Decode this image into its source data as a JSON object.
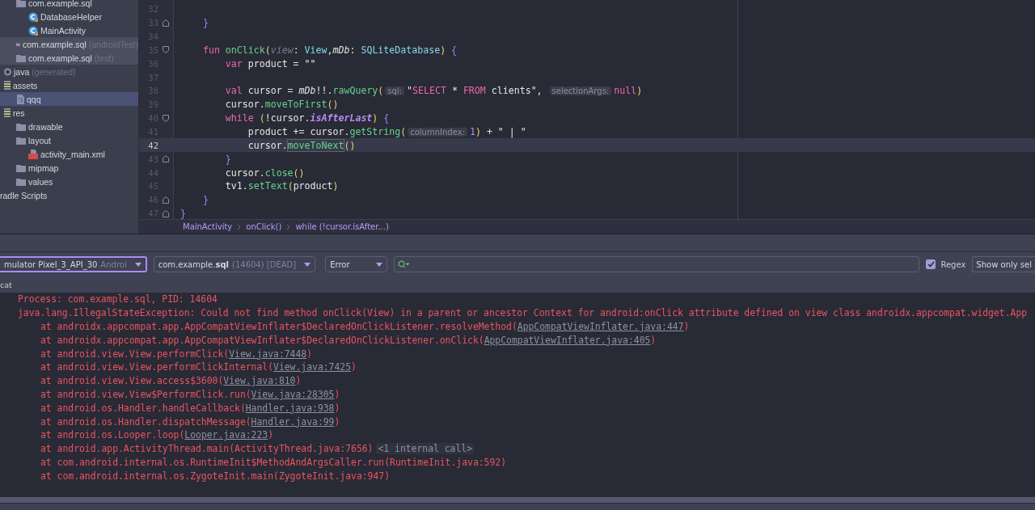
{
  "project_tree": {
    "continued_items": [
      {
        "label": "com.example.sql",
        "kind": "package",
        "selected": false,
        "shaded": false,
        "children": [
          {
            "label": "DatabaseHelper",
            "kind": "class",
            "selected": false,
            "shaded": false
          },
          {
            "label": "MainActivity",
            "kind": "class",
            "selected": false,
            "shaded": false
          }
        ]
      },
      {
        "label": "com.example.sql",
        "suffix": "(androidTest)",
        "kind": "package",
        "selected": false,
        "shaded": true
      },
      {
        "label": "com.example.sql",
        "suffix": "(test)",
        "kind": "package",
        "selected": false,
        "shaded": true
      }
    ],
    "items": [
      {
        "label": "java",
        "suffix": "(generated)",
        "kind": "generated",
        "selected": false,
        "shaded": false
      },
      {
        "label": "assets",
        "kind": "resource-folder",
        "selected": false,
        "shaded": false,
        "children": [
          {
            "label": "qqq",
            "kind": "unknown-file",
            "selected": true,
            "shaded": false
          }
        ]
      },
      {
        "label": "res",
        "kind": "resource-folder",
        "selected": false,
        "shaded": false,
        "children": [
          {
            "label": "drawable",
            "kind": "folder",
            "selected": false,
            "shaded": false
          },
          {
            "label": "layout",
            "kind": "folder",
            "selected": false,
            "shaded": false,
            "children": [
              {
                "label": "activity_main.xml",
                "kind": "layout-file",
                "selected": false,
                "shaded": false
              }
            ]
          },
          {
            "label": "mipmap",
            "kind": "folder",
            "selected": false,
            "shaded": false
          },
          {
            "label": "values",
            "kind": "folder",
            "selected": false,
            "shaded": false
          }
        ]
      },
      {
        "label": "radle Scripts",
        "kind": "plain",
        "selected": false,
        "shaded": false
      }
    ]
  },
  "editor": {
    "lines": [
      {
        "number": "32",
        "kind": "plain",
        "current": false
      },
      {
        "number": "33",
        "kind": "fold-end",
        "current": false,
        "tokens": [
          {
            "kind": "brace",
            "text": "    }"
          }
        ]
      },
      {
        "number": "34",
        "kind": "plain",
        "current": false
      },
      {
        "number": "35",
        "kind": "fold-start",
        "current": false,
        "tokens": [
          {
            "kind": "kw",
            "text": "    fun "
          },
          {
            "kind": "fn",
            "text": "onClick"
          },
          {
            "kind": "paren",
            "text": "("
          },
          {
            "kind": "param",
            "text": "view"
          },
          {
            "kind": "plain",
            "text": ": "
          },
          {
            "kind": "type",
            "text": "View"
          },
          {
            "kind": "plain",
            "text": ","
          },
          {
            "kind": "italic",
            "text": "mDb"
          },
          {
            "kind": "plain",
            "text": ": "
          },
          {
            "kind": "type",
            "text": "SQLiteDatabase"
          },
          {
            "kind": "paren",
            "text": ")"
          },
          {
            "kind": "brace",
            "text": " {"
          }
        ]
      },
      {
        "number": "36",
        "kind": "plain",
        "current": false,
        "tokens": [
          {
            "kind": "kw",
            "text": "        var"
          },
          {
            "kind": "plain",
            "text": " product = \"\""
          }
        ]
      },
      {
        "number": "37",
        "kind": "plain",
        "current": false
      },
      {
        "number": "38",
        "kind": "plain",
        "current": false,
        "tokens": [
          {
            "kind": "kw",
            "text": "        val"
          },
          {
            "kind": "plain",
            "text": " cursor = "
          },
          {
            "kind": "italic",
            "text": "mDb"
          },
          {
            "kind": "plain",
            "text": "!!."
          },
          {
            "kind": "fn",
            "text": "rawQuery"
          },
          {
            "kind": "paren",
            "text": "("
          },
          {
            "kind": "hint",
            "text": "sql:"
          },
          {
            "kind": "plain",
            "text": "\""
          },
          {
            "kind": "kw",
            "text": "SELECT"
          },
          {
            "kind": "plain",
            "text": " * "
          },
          {
            "kind": "kw",
            "text": "FROM"
          },
          {
            "kind": "plain",
            "text": " clients\", "
          },
          {
            "kind": "hint",
            "text": "selectionArgs:"
          },
          {
            "kind": "kw",
            "text": "null"
          },
          {
            "kind": "paren",
            "text": ")"
          }
        ]
      },
      {
        "number": "39",
        "kind": "plain",
        "current": false,
        "tokens": [
          {
            "kind": "plain",
            "text": "        cursor."
          },
          {
            "kind": "fn",
            "text": "moveToFirst"
          },
          {
            "kind": "paren",
            "text": "()"
          }
        ]
      },
      {
        "number": "40",
        "kind": "fold-start",
        "current": false,
        "tokens": [
          {
            "kind": "kw",
            "text": "        while "
          },
          {
            "kind": "paren",
            "text": "("
          },
          {
            "kind": "plain",
            "text": "!cursor."
          },
          {
            "kind": "prop",
            "text": "isAfterLast"
          },
          {
            "kind": "paren",
            "text": ")"
          },
          {
            "kind": "brace",
            "text": " {"
          }
        ]
      },
      {
        "number": "41",
        "kind": "plain",
        "current": false,
        "tokens": [
          {
            "kind": "plain",
            "text": "            product += cursor."
          },
          {
            "kind": "fn",
            "text": "getString"
          },
          {
            "kind": "paren",
            "text": "("
          },
          {
            "kind": "hint",
            "text": "columnIndex:"
          },
          {
            "kind": "num",
            "text": "1"
          },
          {
            "kind": "paren",
            "text": ")"
          },
          {
            "kind": "plain",
            "text": " + \" | \""
          }
        ]
      },
      {
        "number": "42",
        "kind": "plain",
        "current": true,
        "tokens": [
          {
            "kind": "plain",
            "text": "            cursor."
          },
          {
            "kind": "fn-marked",
            "text": "moveToNext"
          },
          {
            "kind": "paren",
            "text": "()"
          }
        ]
      },
      {
        "number": "43",
        "kind": "fold-end",
        "current": false,
        "tokens": [
          {
            "kind": "brace",
            "text": "        }"
          }
        ]
      },
      {
        "number": "44",
        "kind": "plain",
        "current": false,
        "tokens": [
          {
            "kind": "plain",
            "text": "        cursor."
          },
          {
            "kind": "fn",
            "text": "close"
          },
          {
            "kind": "paren",
            "text": "()"
          }
        ]
      },
      {
        "number": "45",
        "kind": "plain",
        "current": false,
        "tokens": [
          {
            "kind": "plain",
            "text": "        tv1."
          },
          {
            "kind": "fn",
            "text": "setText"
          },
          {
            "kind": "paren",
            "text": "("
          },
          {
            "kind": "plain",
            "text": "product"
          },
          {
            "kind": "paren",
            "text": ")"
          }
        ]
      },
      {
        "number": "46",
        "kind": "fold-end",
        "current": false,
        "tokens": [
          {
            "kind": "brace",
            "text": "    }"
          }
        ]
      },
      {
        "number": "47",
        "kind": "fold-end",
        "current": false,
        "tokens": [
          {
            "kind": "brace",
            "text": "}"
          }
        ]
      }
    ],
    "breadcrumbs": [
      "MainActivity",
      "onClick()",
      "while (!cursor.isAfter...)"
    ]
  },
  "logcat": {
    "device": {
      "value": "mulator Pixel_3_API_30",
      "detail": "Androi"
    },
    "process": {
      "value": "com.example.**sql**",
      "detail": "(14604) [DEAD]"
    },
    "level": "Error",
    "regex": {
      "label": "Regex",
      "checked": true
    },
    "filter": "Show only sel",
    "tab": "cat",
    "lines": [
      {
        "kind": "process",
        "segments": [
          {
            "kind": "text",
            "text": "Process: com.example.sql, PID: 14604"
          }
        ]
      },
      {
        "kind": "exception",
        "segments": [
          {
            "kind": "text",
            "text": "java.lang.IllegalStateException: Could not find method onClick(View) in a parent or ancestor Context for android:onClick attribute defined on view class androidx.appcompat.widget.App"
          }
        ]
      },
      {
        "kind": "frame",
        "segments": [
          {
            "kind": "text",
            "text": "at androidx.appcompat.app.AppCompatViewInflater$DeclaredOnClickListener.resolveMethod("
          },
          {
            "kind": "link",
            "text": "AppCompatViewInflater.java:447"
          },
          {
            "kind": "text",
            "text": ")"
          }
        ]
      },
      {
        "kind": "frame",
        "segments": [
          {
            "kind": "text",
            "text": "at androidx.appcompat.app.AppCompatViewInflater$DeclaredOnClickListener.onClick("
          },
          {
            "kind": "link",
            "text": "AppCompatViewInflater.java:405"
          },
          {
            "kind": "text",
            "text": ")"
          }
        ]
      },
      {
        "kind": "frame",
        "segments": [
          {
            "kind": "text",
            "text": "at android.view.View.performClick("
          },
          {
            "kind": "link",
            "text": "View.java:7448"
          },
          {
            "kind": "text",
            "text": ")"
          }
        ]
      },
      {
        "kind": "frame",
        "segments": [
          {
            "kind": "text",
            "text": "at android.view.View.performClickInternal("
          },
          {
            "kind": "link",
            "text": "View.java:7425"
          },
          {
            "kind": "text",
            "text": ")"
          }
        ]
      },
      {
        "kind": "frame",
        "segments": [
          {
            "kind": "text",
            "text": "at android.view.View.access$3600("
          },
          {
            "kind": "link",
            "text": "View.java:810"
          },
          {
            "kind": "text",
            "text": ")"
          }
        ]
      },
      {
        "kind": "frame",
        "segments": [
          {
            "kind": "text",
            "text": "at android.view.View$PerformClick.run("
          },
          {
            "kind": "link",
            "text": "View.java:28305"
          },
          {
            "kind": "text",
            "text": ")"
          }
        ]
      },
      {
        "kind": "frame",
        "segments": [
          {
            "kind": "text",
            "text": "at android.os.Handler.handleCallback("
          },
          {
            "kind": "link",
            "text": "Handler.java:938"
          },
          {
            "kind": "text",
            "text": ")"
          }
        ]
      },
      {
        "kind": "frame",
        "segments": [
          {
            "kind": "text",
            "text": "at android.os.Handler.dispatchMessage("
          },
          {
            "kind": "link",
            "text": "Handler.java:99"
          },
          {
            "kind": "text",
            "text": ")"
          }
        ]
      },
      {
        "kind": "frame",
        "segments": [
          {
            "kind": "text",
            "text": "at android.os.Looper.loop("
          },
          {
            "kind": "link",
            "text": "Looper.java:223"
          },
          {
            "kind": "text",
            "text": ")"
          }
        ]
      },
      {
        "kind": "frame",
        "segments": [
          {
            "kind": "text",
            "text": "at android.app.ActivityThread.main(ActivityThread.java:7656)"
          },
          {
            "kind": "note",
            "text": "<1 internal call>"
          }
        ]
      },
      {
        "kind": "frame",
        "segments": [
          {
            "kind": "text",
            "text": "at com.android.internal.os.RuntimeInit$MethodAndArgsCaller.run(RuntimeInit.java:592)"
          }
        ]
      },
      {
        "kind": "frame",
        "segments": [
          {
            "kind": "text",
            "text": "at com.android.internal.os.ZygoteInit.main(ZygoteInit.java:947)"
          }
        ]
      }
    ]
  }
}
